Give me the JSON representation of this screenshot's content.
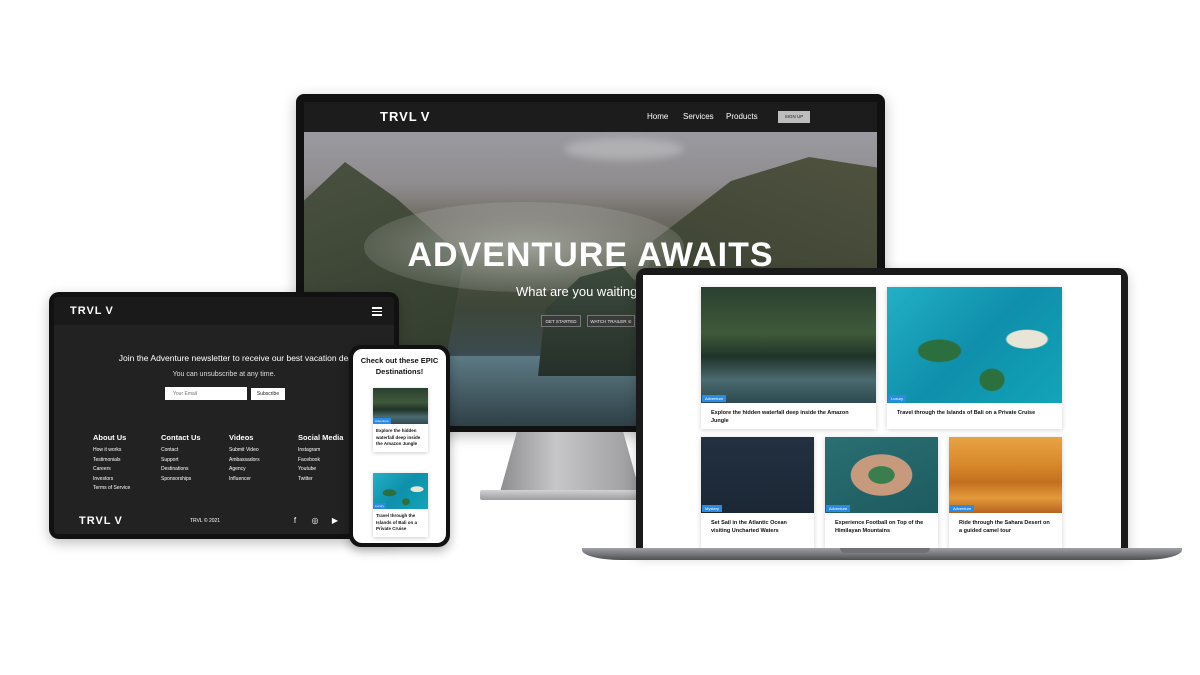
{
  "brand": {
    "logo_text": "TRVL",
    "logo_mark": "V"
  },
  "monitor": {
    "nav": {
      "links": [
        "Home",
        "Services",
        "Products"
      ],
      "signup_label": "SIGN UP"
    },
    "hero": {
      "title": "ADVENTURE AWAITS",
      "subtitle": "What are you waiting",
      "primary_button": "GET STARTED",
      "secondary_button": "WATCH TRAILER ⊙"
    }
  },
  "tablet": {
    "newsletter": {
      "title": "Join the Adventure newsletter to receive our best vacation deals",
      "subtitle": "You can unsubscribe at any time.",
      "email_placeholder": "Your Email",
      "subscribe_label": "Subscribe"
    },
    "footer_columns": [
      {
        "heading": "About Us",
        "items": [
          "How it works",
          "Testimonials",
          "Careers",
          "Investors",
          "Terms of Service"
        ]
      },
      {
        "heading": "Contact Us",
        "items": [
          "Contact",
          "Support",
          "Destinations",
          "Sponsorships"
        ]
      },
      {
        "heading": "Videos",
        "items": [
          "Submit Video",
          "Ambassadors",
          "Agency",
          "Influencer"
        ]
      },
      {
        "heading": "Social Media",
        "items": [
          "Instagram",
          "Facebook",
          "Youtube",
          "Twitter"
        ]
      }
    ],
    "copyright": "TRVL © 2021",
    "social_icons": [
      "facebook-icon",
      "instagram-icon",
      "youtube-icon"
    ]
  },
  "phone": {
    "heading": "Check out these EPIC Destinations!",
    "cards": [
      {
        "tag": "Adventure",
        "text": "Explore the hidden waterfall deep inside the Amazon Jungle"
      },
      {
        "tag": "Luxury",
        "text": "Travel through the Islands of Bali on a Private Cruise"
      }
    ]
  },
  "laptop": {
    "cards": [
      {
        "tag": "Adventure",
        "text": "Explore the hidden waterfall deep inside the Amazon Jungle"
      },
      {
        "tag": "Luxury",
        "text": "Travel through the Islands of Bali on a Private Cruise"
      },
      {
        "tag": "Mystery",
        "text": "Set Sail in the Atlantic Ocean visiting Uncharted Waters"
      },
      {
        "tag": "Adventure",
        "text": "Experience Football on Top of the Himilayan Mountains"
      },
      {
        "tag": "Adventure",
        "text": "Ride through the Sahara Desert on a guided camel tour"
      }
    ]
  },
  "colors": {
    "accent_tag": "#2b8ae2",
    "dark_bg": "#1c1c1c"
  }
}
